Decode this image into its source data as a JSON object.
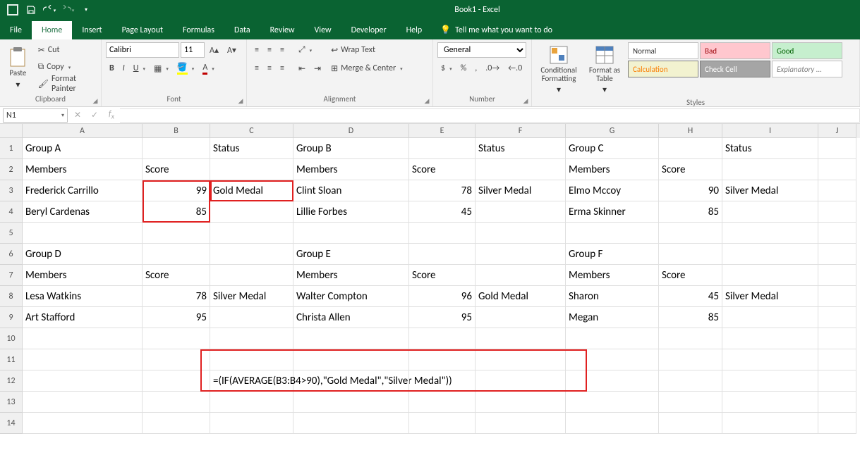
{
  "window": {
    "title": "Book1 - Excel"
  },
  "tabs": {
    "file": "File",
    "home": "Home",
    "insert": "Insert",
    "page_layout": "Page Layout",
    "formulas": "Formulas",
    "data": "Data",
    "review": "Review",
    "view": "View",
    "developer": "Developer",
    "help": "Help",
    "tellme": "Tell me what you want to do"
  },
  "ribbon": {
    "clipboard": {
      "label": "Clipboard",
      "paste": "Paste",
      "cut": "Cut",
      "copy": "Copy",
      "format_painter": "Format Painter"
    },
    "font": {
      "label": "Font",
      "name": "Calibri",
      "size": "11"
    },
    "alignment": {
      "label": "Alignment",
      "wrap": "Wrap Text",
      "merge": "Merge & Center"
    },
    "number": {
      "label": "Number",
      "format": "General"
    },
    "styles": {
      "label": "Styles",
      "cond": "Conditional Formatting",
      "table": "Format as Table",
      "normal": "Normal",
      "bad": "Bad",
      "good": "Good",
      "calc": "Calculation",
      "check": "Check Cell",
      "exp": "Explanatory ..."
    }
  },
  "namebox": "N1",
  "formula_bar": "",
  "columns": [
    "A",
    "B",
    "C",
    "D",
    "E",
    "F",
    "G",
    "H",
    "I",
    "J"
  ],
  "rows": [
    "1",
    "2",
    "3",
    "4",
    "5",
    "6",
    "7",
    "8",
    "9",
    "10",
    "11",
    "12",
    "13",
    "14"
  ],
  "cells": {
    "A1": "Group A",
    "C1": "Status",
    "D1": "Group B",
    "F1": "Status",
    "G1": "Group C",
    "I1": "Status",
    "A2": "Members",
    "B2": "Score",
    "D2": "Members",
    "E2": "Score",
    "G2": "Members",
    "H2": "Score",
    "A3": "Frederick Carrillo",
    "B3": "99",
    "C3": "Gold Medal",
    "D3": "Clint Sloan",
    "E3": "78",
    "F3": "Silver Medal",
    "G3": "Elmo Mccoy",
    "H3": "90",
    "I3": "Silver Medal",
    "A4": "Beryl Cardenas",
    "B4": "85",
    "D4": "Lillie Forbes",
    "E4": "45",
    "G4": "Erma Skinner",
    "H4": "85",
    "A6": "Group D",
    "D6": "Group E",
    "G6": "Group F",
    "A7": "Members",
    "B7": "Score",
    "D7": "Members",
    "E7": "Score",
    "G7": "Members",
    "H7": "Score",
    "A8": "Lesa Watkins",
    "B8": "78",
    "C8": "Silver Medal",
    "D8": "Walter Compton",
    "E8": "96",
    "F8": "Gold Medal",
    "G8": "Sharon",
    "H8": "45",
    "I8": "Silver Medal",
    "A9": "Art Stafford",
    "B9": "95",
    "D9": "Christa Allen",
    "E9": "95",
    "G9": "Megan",
    "H9": "85",
    "C12": "=(IF(AVERAGE(B3:B4>90),\"Gold Medal\",\"Silver Medal\"))"
  }
}
